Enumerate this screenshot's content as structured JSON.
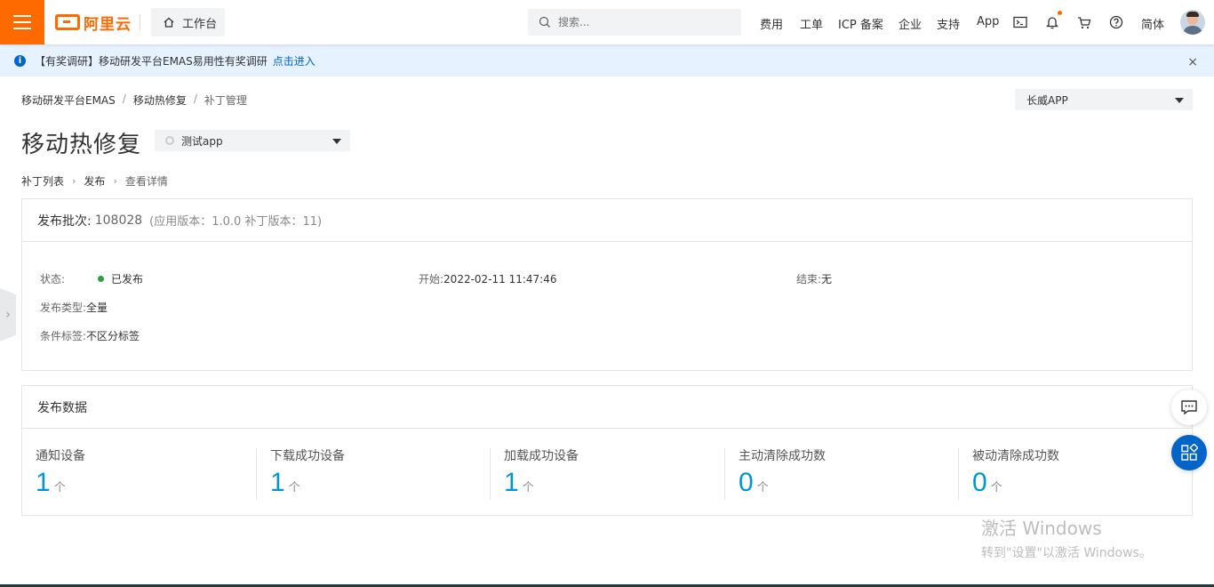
{
  "colors": {
    "brand": "#ff6a00",
    "link": "#0064c8",
    "stat_value": "#0096d6",
    "status_ok": "#2e9e44"
  },
  "topbar": {
    "logo_text": "阿里云",
    "workbench_label": "工作台",
    "search_placeholder": "搜索...",
    "nav": [
      "费用",
      "工单",
      "ICP 备案",
      "企业",
      "支持",
      "App"
    ],
    "language": "简体",
    "icons": [
      "menu-icon",
      "home-icon",
      "search-icon",
      "terminal-icon",
      "bell-icon",
      "cart-icon",
      "help-icon"
    ]
  },
  "notice": {
    "text": "【有奖调研】移动研发平台EMAS易用性有奖调研",
    "link": "点击进入",
    "close": "×"
  },
  "breadcrumb": [
    "移动研发平台EMAS",
    "移动热修复",
    "补丁管理"
  ],
  "region_select": {
    "value": "长威APP"
  },
  "page": {
    "title": "移动热修复",
    "app_select": "测试app"
  },
  "steps": [
    "补丁列表",
    "发布",
    "查看详情"
  ],
  "release": {
    "batch_label": "发布批次:",
    "batch_value": "108028",
    "version_info": "(应用版本：1.0.0 补丁版本：11)",
    "status_label": "状态:",
    "status_value": "已发布",
    "start_label": "开始:",
    "start_value": "2022-02-11 11:47:46",
    "end_label": "结束:",
    "end_value": "无",
    "type_label": "发布类型:",
    "type_value": "全量",
    "tag_label": "条件标签:",
    "tag_value": "不区分标签"
  },
  "release_data": {
    "title": "发布数据",
    "unit": "个",
    "stats": [
      {
        "label": "通知设备",
        "value": "1"
      },
      {
        "label": "下载成功设备",
        "value": "1"
      },
      {
        "label": "加载成功设备",
        "value": "1"
      },
      {
        "label": "主动清除成功数",
        "value": "0"
      },
      {
        "label": "被动清除成功数",
        "value": "0"
      }
    ]
  },
  "watermark": {
    "line1": "激活 Windows",
    "line2": "转到\"设置\"以激活 Windows。"
  }
}
